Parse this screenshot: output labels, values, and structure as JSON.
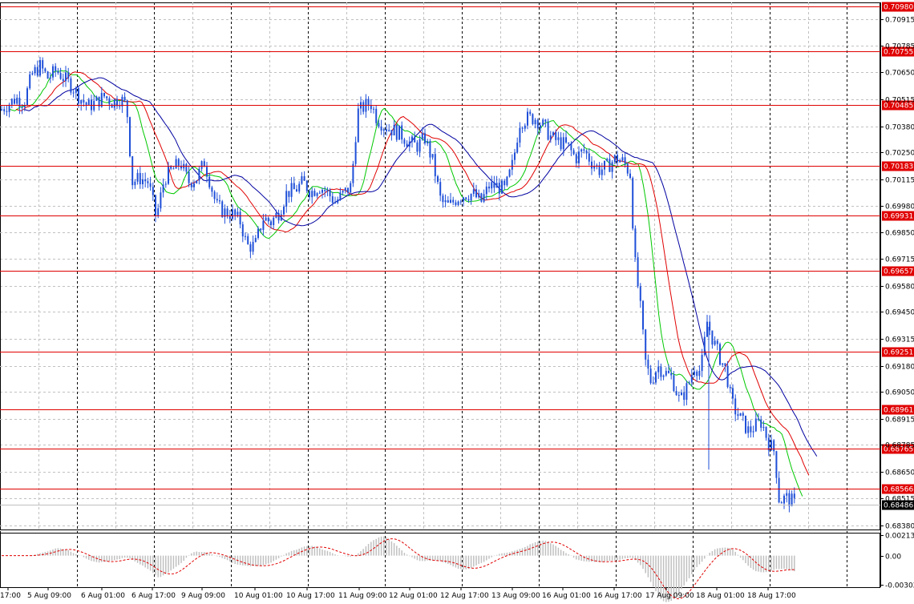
{
  "chart_data": {
    "type": "candlestick",
    "symbol": "",
    "colors": {
      "background": "#ffffff",
      "grid": "#c0c0c0",
      "candles": "#1f4fd8",
      "ma_fast": "#00c800",
      "ma_mid": "#e00000",
      "ma_slow": "#0000a0",
      "levels": "#e00000",
      "osc_hist": "#c0c0c0",
      "osc_signal": "#e00000"
    },
    "y_axis_ticks": [
      "0.70915",
      "0.70785",
      "0.70650",
      "0.70515",
      "0.70380",
      "0.70250",
      "0.70115",
      "0.69980",
      "0.69850",
      "0.69715",
      "0.69580",
      "0.69450",
      "0.69315",
      "0.69180",
      "0.69050",
      "0.68915",
      "0.68785",
      "0.68650",
      "0.68515",
      "0.68380"
    ],
    "ylim": [
      0.6836,
      0.71
    ],
    "levels": [
      "0.70980",
      "0.70755",
      "0.70485",
      "0.70183",
      "0.69931",
      "0.69657",
      "0.69251",
      "0.68961",
      "0.68765",
      "0.68566"
    ],
    "current_price": "0.68486",
    "x_axis_ticks": [
      "17:00",
      "5 Aug 09:00",
      "6 Aug 01:00",
      "6 Aug 17:00",
      "9 Aug 09:00",
      "10 Aug 01:00",
      "10 Aug 17:00",
      "11 Aug 09:00",
      "12 Aug 01:00",
      "12 Aug 17:00",
      "13 Aug 09:00",
      "16 Aug 01:00",
      "16 Aug 17:00",
      "17 Aug 09:00",
      "18 Aug 01:00",
      "18 Aug 17:00"
    ],
    "oscillator": {
      "ticks": [
        "0.00213",
        "0.00",
        "-0.00302"
      ],
      "ylim": [
        -0.0033,
        0.0024
      ]
    },
    "price_path": [
      [
        0,
        0.7046
      ],
      [
        10,
        0.7049
      ],
      [
        20,
        0.7052
      ],
      [
        30,
        0.705
      ],
      [
        40,
        0.7064
      ],
      [
        50,
        0.7068
      ],
      [
        60,
        0.7062
      ],
      [
        70,
        0.7066
      ],
      [
        80,
        0.7062
      ],
      [
        90,
        0.7058
      ],
      [
        100,
        0.7052
      ],
      [
        110,
        0.7048
      ],
      [
        120,
        0.705
      ],
      [
        130,
        0.7053
      ],
      [
        140,
        0.705
      ],
      [
        150,
        0.7052
      ],
      [
        158,
        0.7048
      ],
      [
        165,
        0.701
      ],
      [
        175,
        0.7012
      ],
      [
        185,
        0.701
      ],
      [
        195,
        0.6992
      ],
      [
        205,
        0.7012
      ],
      [
        215,
        0.7016
      ],
      [
        225,
        0.702
      ],
      [
        235,
        0.701
      ],
      [
        245,
        0.7012
      ],
      [
        255,
        0.702
      ],
      [
        262,
        0.701
      ],
      [
        270,
        0.6998
      ],
      [
        280,
        0.6995
      ],
      [
        290,
        0.6994
      ],
      [
        300,
        0.699
      ],
      [
        308,
        0.6978
      ],
      [
        318,
        0.6978
      ],
      [
        328,
        0.6992
      ],
      [
        338,
        0.699
      ],
      [
        348,
        0.6995
      ],
      [
        358,
        0.7005
      ],
      [
        368,
        0.7006
      ],
      [
        378,
        0.701
      ],
      [
        388,
        0.7005
      ],
      [
        398,
        0.7008
      ],
      [
        408,
        0.7005
      ],
      [
        418,
        0.7
      ],
      [
        428,
        0.7004
      ],
      [
        438,
        0.7008
      ],
      [
        446,
        0.7045
      ],
      [
        455,
        0.7048
      ],
      [
        462,
        0.705
      ],
      [
        470,
        0.7042
      ],
      [
        480,
        0.7038
      ],
      [
        490,
        0.7036
      ],
      [
        500,
        0.7034
      ],
      [
        510,
        0.703
      ],
      [
        520,
        0.7028
      ],
      [
        530,
        0.7032
      ],
      [
        540,
        0.702
      ],
      [
        550,
        0.7
      ],
      [
        560,
        0.6998
      ],
      [
        570,
        0.7002
      ],
      [
        580,
        0.7004
      ],
      [
        590,
        0.7004
      ],
      [
        600,
        0.7
      ],
      [
        610,
        0.7008
      ],
      [
        620,
        0.7008
      ],
      [
        630,
        0.7006
      ],
      [
        640,
        0.702
      ],
      [
        648,
        0.704
      ],
      [
        658,
        0.7042
      ],
      [
        668,
        0.7042
      ],
      [
        678,
        0.7038
      ],
      [
        688,
        0.7032
      ],
      [
        698,
        0.703
      ],
      [
        708,
        0.7028
      ],
      [
        718,
        0.7022
      ],
      [
        728,
        0.7026
      ],
      [
        738,
        0.702
      ],
      [
        748,
        0.7016
      ],
      [
        758,
        0.7018
      ],
      [
        768,
        0.7022
      ],
      [
        778,
        0.702
      ],
      [
        786,
        0.7014
      ],
      [
        792,
        0.697
      ],
      [
        798,
        0.695
      ],
      [
        805,
        0.692
      ],
      [
        812,
        0.691
      ],
      [
        820,
        0.6918
      ],
      [
        828,
        0.6915
      ],
      [
        838,
        0.6912
      ],
      [
        848,
        0.69
      ],
      [
        858,
        0.6908
      ],
      [
        866,
        0.6918
      ],
      [
        874,
        0.6915
      ],
      [
        882,
        0.694
      ],
      [
        890,
        0.693
      ],
      [
        898,
        0.6922
      ],
      [
        906,
        0.6915
      ],
      [
        912,
        0.69
      ],
      [
        918,
        0.6895
      ],
      [
        926,
        0.689
      ],
      [
        934,
        0.6885
      ],
      [
        942,
        0.6888
      ],
      [
        950,
        0.689
      ],
      [
        958,
        0.688
      ],
      [
        966,
        0.6875
      ],
      [
        972,
        0.685
      ],
      [
        980,
        0.6852
      ],
      [
        988,
        0.685
      ],
      [
        993,
        0.6848
      ]
    ]
  }
}
